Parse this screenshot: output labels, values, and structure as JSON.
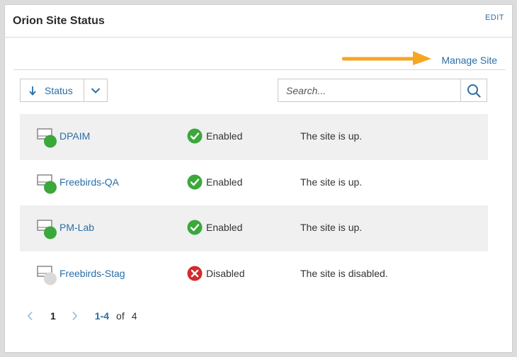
{
  "panel": {
    "title": "Orion Site Status",
    "edit_label": "EDIT",
    "manage_site_label": "Manage Site"
  },
  "toolbar": {
    "sort_label": "Status",
    "search_placeholder": "Search..."
  },
  "sites": [
    {
      "name": "DPAIM",
      "status": "Enabled",
      "description": "The site is up."
    },
    {
      "name": "Freebirds-QA",
      "status": "Enabled",
      "description": "The site is up."
    },
    {
      "name": "PM-Lab",
      "status": "Enabled",
      "description": "The site is up."
    },
    {
      "name": "Freebirds-Stag",
      "status": "Disabled",
      "description": "The site is disabled."
    }
  ],
  "pagination": {
    "current_page": "1",
    "range": "1-4",
    "of_label": "of",
    "total": "4"
  },
  "colors": {
    "link": "#2a6ea6",
    "enabled": "#3aa83a",
    "disabled": "#d62a2a",
    "annotation_arrow": "#f5a623"
  }
}
